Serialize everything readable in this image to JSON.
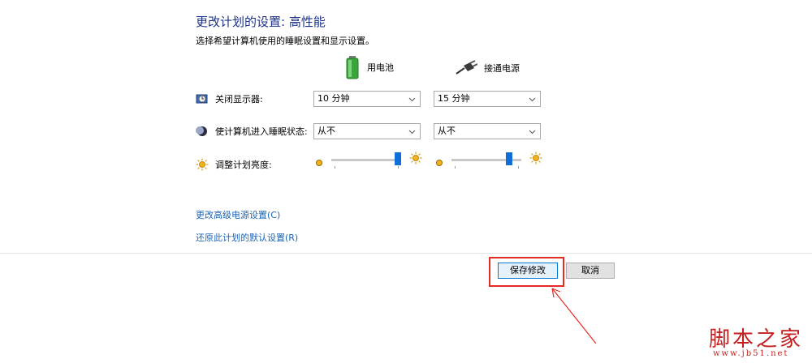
{
  "header": {
    "title": "更改计划的设置: 高性能",
    "subtitle": "选择希望计算机使用的睡眠设置和显示设置。"
  },
  "columns": {
    "battery": {
      "label": "用电池",
      "icon": "battery-icon"
    },
    "plugged": {
      "label": "接通电源",
      "icon": "power-plug-icon"
    }
  },
  "settings": {
    "display": {
      "label": "关闭显示器:",
      "icon": "monitor-clock-icon",
      "battery_value": "10 分钟",
      "plugged_value": "15 分钟"
    },
    "sleep": {
      "label": "使计算机进入睡眠状态:",
      "icon": "moon-icon",
      "battery_value": "从不",
      "plugged_value": "从不"
    },
    "brightness": {
      "label": "调整计划亮度:",
      "icon": "sun-icon",
      "battery_level": 0.95,
      "plugged_level": 0.82
    }
  },
  "links": {
    "advanced": "更改高级电源设置(C)",
    "restore": "还原此计划的默认设置(R)"
  },
  "buttons": {
    "save": "保存修改",
    "cancel": "取消"
  },
  "watermark": {
    "main": "脚本之家",
    "url": "www.jb51.net"
  },
  "colors": {
    "title": "#1e3287",
    "link": "#1e64b4",
    "accent": "#0f6fd6",
    "highlight": "#e62b25"
  }
}
